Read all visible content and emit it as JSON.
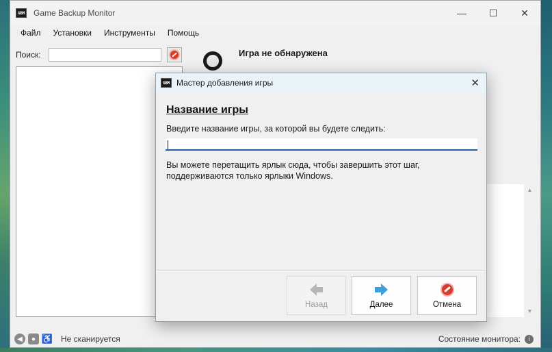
{
  "window": {
    "title": "Game Backup Monitor",
    "icon_text": "GBM",
    "controls": {
      "minimize": "—",
      "maximize": "☐",
      "close": "✕"
    }
  },
  "menu": [
    {
      "label": "Файл"
    },
    {
      "label": "Установки"
    },
    {
      "label": "Инструменты"
    },
    {
      "label": "Помощь"
    }
  ],
  "search": {
    "label": "Поиск:",
    "value": ""
  },
  "detection": {
    "status": "Игра не обнаружена"
  },
  "statusbar": {
    "scan_status": "Не сканируется",
    "monitor_label": "Состояние монитора:"
  },
  "dialog": {
    "icon_text": "GBM",
    "title": "Мастер добавления игры",
    "close": "✕",
    "heading": "Название игры",
    "prompt": "Введите название игры, за которой вы будете следить:",
    "input_value": "",
    "hint_line1": "Вы можете перетащить ярлык сюда, чтобы завершить этот шаг,",
    "hint_line2": "поддерживаются только ярлыки Windows.",
    "buttons": {
      "back": "Назад",
      "next": "Далее",
      "cancel": "Отмена"
    }
  },
  "colors": {
    "accent": "#1f5fa8",
    "next_arrow": "#3ba0dc",
    "cancel_red": "#d83a2c",
    "dialog_titlebar": "#eaf4f8"
  },
  "icons": {
    "back": "arrow-left-icon",
    "next": "arrow-right-icon",
    "cancel": "no-entry-icon",
    "clear_search": "no-entry-icon",
    "detect": "magnifier-icon"
  }
}
